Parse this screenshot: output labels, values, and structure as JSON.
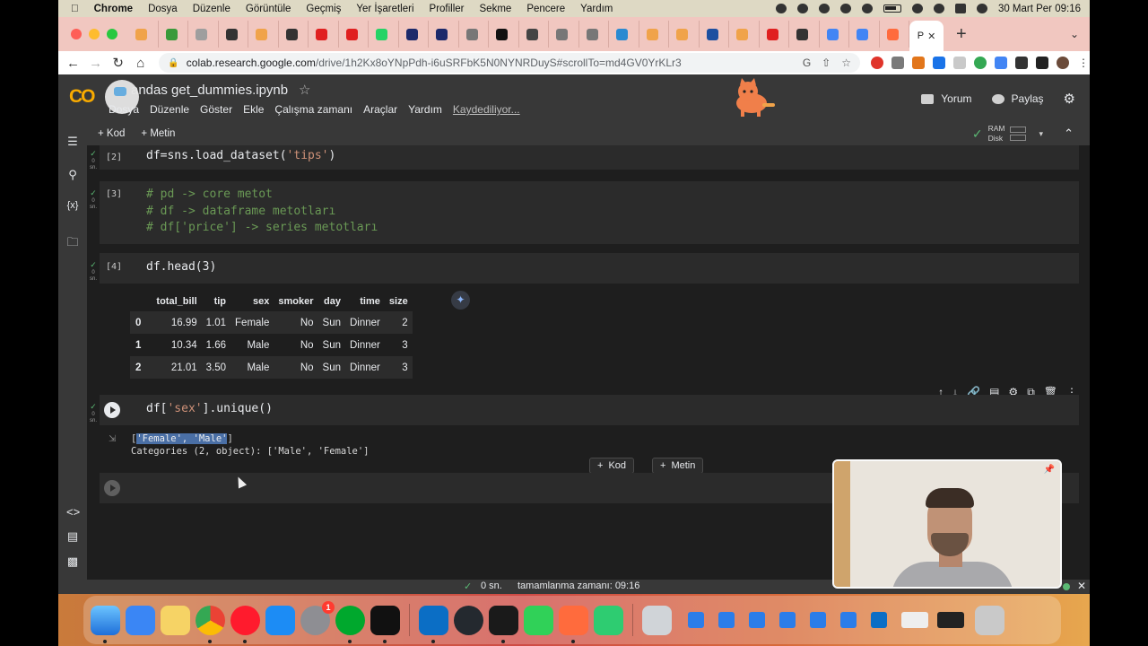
{
  "menubar": {
    "app": "Chrome",
    "items": [
      "Dosya",
      "Düzenle",
      "Görüntüle",
      "Geçmiş",
      "Yer İşaretleri",
      "Profiller",
      "Sekme",
      "Pencere",
      "Yardım"
    ],
    "clock": "30 Mart Per  09:16"
  },
  "browser": {
    "active_tab_title": "P",
    "url_host": "colab.research.google.com",
    "url_path": "/drive/1h2Kx8oYNpPdh-i6uSRFbK5N0NYNRDuyS#scrollTo=md4GV0YrKLr3"
  },
  "colab": {
    "logo": "CO",
    "notebook_title": "andas get_dummies.ipynb",
    "menu": [
      "Dosya",
      "Düzenle",
      "Göster",
      "Ekle",
      "Çalışma zamanı",
      "Araçlar",
      "Yardım"
    ],
    "save_status": "Kaydediliyor...",
    "comment_label": "Yorum",
    "share_label": "Paylaş",
    "add_code": "Kod",
    "add_text": "Metin",
    "ram_label": "RAM",
    "disk_label": "Disk"
  },
  "cells": {
    "c2": {
      "count": "[2]",
      "status": "0\nsn.",
      "code": "df=sns.load_dataset('tips')"
    },
    "c3": {
      "count": "[3]",
      "status": "0\nsn.",
      "lines": [
        "# pd -> core metot",
        "# df -> dataframe metotları",
        "# df['price'] -> series metotları"
      ]
    },
    "c4": {
      "count": "[4]",
      "status": "0\nsn.",
      "code": "df.head(3)",
      "table": {
        "columns": [
          "",
          "total_bill",
          "tip",
          "sex",
          "smoker",
          "day",
          "time",
          "size"
        ],
        "rows": [
          [
            "0",
            "16.99",
            "1.01",
            "Female",
            "No",
            "Sun",
            "Dinner",
            "2"
          ],
          [
            "1",
            "10.34",
            "1.66",
            "Male",
            "No",
            "Sun",
            "Dinner",
            "3"
          ],
          [
            "2",
            "21.01",
            "3.50",
            "Male",
            "No",
            "Sun",
            "Dinner",
            "3"
          ]
        ]
      }
    },
    "c5": {
      "status": "0\nsn.",
      "code_pre": "df[",
      "code_str": "'sex'",
      "code_post": "].unique()",
      "out_open": "[",
      "out_selected": "'Female', 'Male'",
      "out_close": "]",
      "out_line2": "Categories (2, object): ['Male', 'Female']"
    }
  },
  "statusbar": {
    "check": "✓",
    "seconds": "0 sn.",
    "completion": "tamamlanma zamanı: 09:16"
  }
}
